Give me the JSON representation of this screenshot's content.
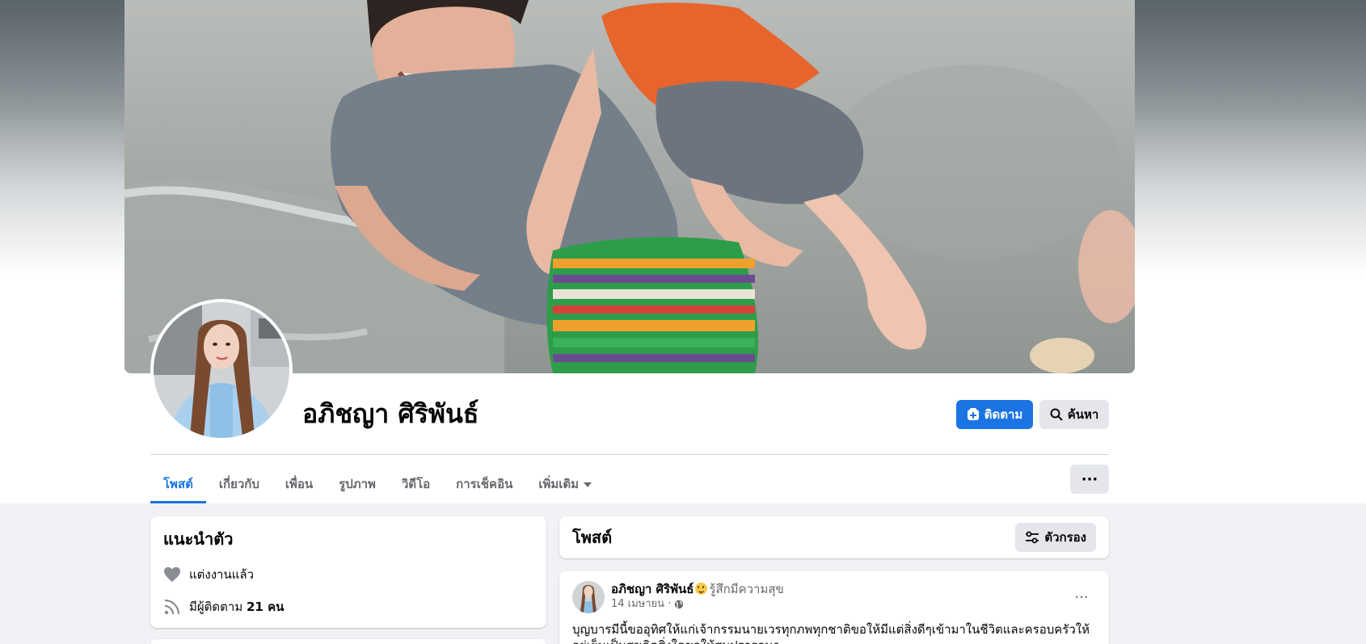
{
  "profile": {
    "name": "อภิชญา ศิริพันธ์"
  },
  "actions": {
    "follow_label": "ติดตาม",
    "search_label": "ค้นหา",
    "more_label": "···"
  },
  "tabs": [
    {
      "label": "โพสต์",
      "active": true
    },
    {
      "label": "เกี่ยวกับ",
      "active": false
    },
    {
      "label": "เพื่อน",
      "active": false
    },
    {
      "label": "รูปภาพ",
      "active": false
    },
    {
      "label": "วิดีโอ",
      "active": false
    },
    {
      "label": "การเช็คอิน",
      "active": false
    },
    {
      "label": "เพิ่มเติม",
      "active": false
    }
  ],
  "intro": {
    "title": "แนะนำตัว",
    "relationship": "แต่งงานแล้ว",
    "followers_prefix": "มีผู้ติดตาม",
    "followers_count": "21 คน"
  },
  "posts_section": {
    "title": "โพสต์",
    "filter_label": "ตัวกรอง"
  },
  "post": {
    "author": "อภิชญา ศิริพันธ์",
    "feeling": "รู้สึกมีความสุข",
    "date": "14 เมษายน ·",
    "text": "บุญบารมีนี้ขออุทิศให้แก่เจ้ากรรมนายเวรทุกภพทุกชาติขอให้มีแต่สิ่งดีๆเข้ามาในชีวิตและครอบครัวให้อยู่เย็นเป็นสุขคิดสิ่งใดขอให้สมปรารถนา"
  },
  "icons": {
    "follow": "follow-add-icon",
    "search": "search-icon",
    "more": "more-dots-icon",
    "filter": "filter-sliders-icon",
    "heart": "heart-icon",
    "rss": "followers-feed-icon",
    "globe": "globe-icon",
    "caret": "caret-down-icon",
    "feeling": "smiley-emoji-icon"
  },
  "colors": {
    "accent": "#1b74e4",
    "background": "#f0f2f5",
    "button_gray": "#e4e6eb",
    "secondary_text": "#65676b"
  }
}
